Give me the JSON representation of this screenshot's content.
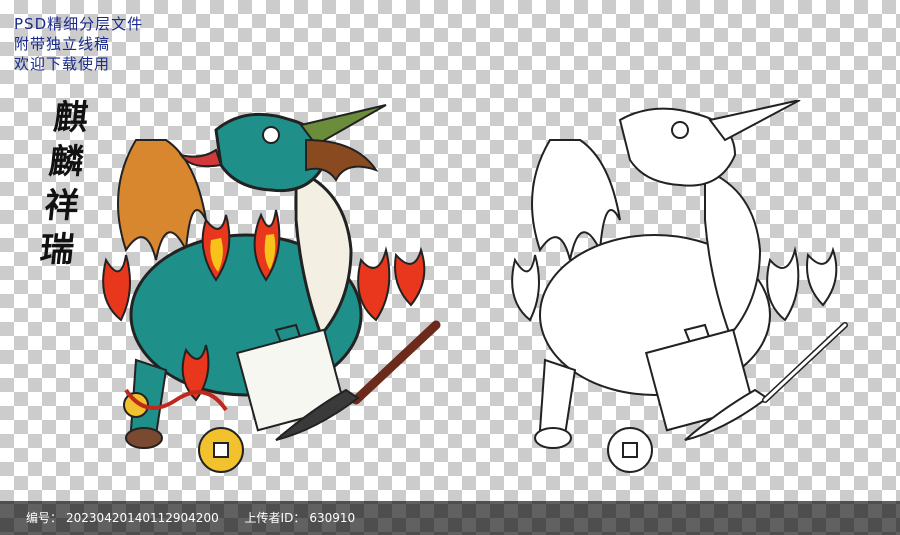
{
  "promo": {
    "line1": "PSD精细分层文件",
    "line2": "附带独立线稿",
    "line3": "欢迎下载使用"
  },
  "calligraphy": {
    "chars": [
      "麒",
      "麟",
      "祥",
      "瑞"
    ]
  },
  "footer": {
    "id_label": "编号：",
    "id_value": "20230420140112904200",
    "uploader_label": "上传者ID：",
    "uploader_value": "630910"
  },
  "colors": {
    "scales": "#1f8f8a",
    "flame_outer": "#e8371c",
    "flame_inner": "#f7c21a",
    "belly": "#f3efe2",
    "mane": "#d9872f",
    "coin": "#f2c12e",
    "footer_bg": "#000000"
  }
}
